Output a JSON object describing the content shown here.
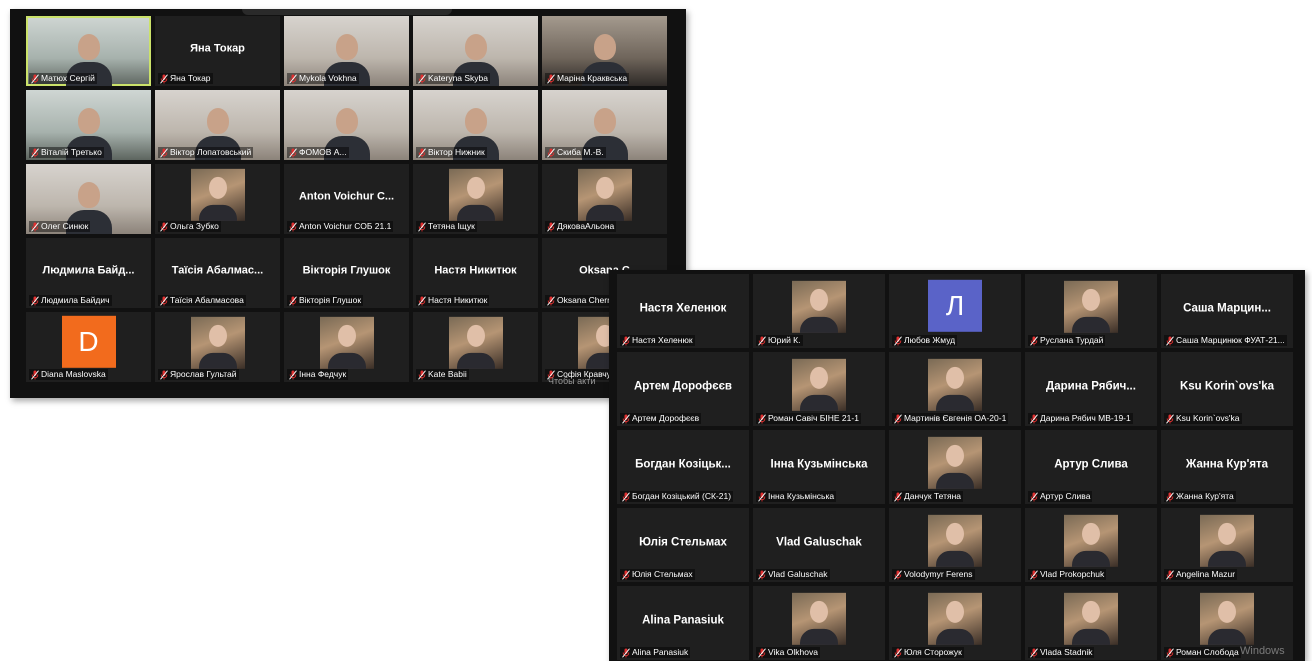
{
  "window1": {
    "tiles": [
      {
        "kind": "video",
        "shade": "cool",
        "label": "Матюх Сергій",
        "active": true
      },
      {
        "kind": "name",
        "big": "Яна Токар",
        "label": "Яна Токар"
      },
      {
        "kind": "video",
        "shade": "warm",
        "label": "Mykola Vokhna"
      },
      {
        "kind": "video",
        "shade": "warm",
        "label": "Kateryna Skyba"
      },
      {
        "kind": "video",
        "shade": "dark",
        "label": "Маріна Краквська"
      },
      {
        "kind": "video",
        "shade": "cool",
        "label": "Віталій Третько"
      },
      {
        "kind": "video",
        "shade": "warm",
        "label": "Віктор Лопатовський"
      },
      {
        "kind": "video",
        "shade": "warm",
        "label": "ФОМОВ А..."
      },
      {
        "kind": "video",
        "shade": "warm",
        "label": "Віктор Нижник"
      },
      {
        "kind": "video",
        "shade": "warm",
        "label": "Скиба М.-В."
      },
      {
        "kind": "video",
        "shade": "warm",
        "label": "Олег Синюк"
      },
      {
        "kind": "photo",
        "label": "Ольга Зубко"
      },
      {
        "kind": "name",
        "big": "Anton Voichur C...",
        "label": "Anton Voichur СОБ 21.1"
      },
      {
        "kind": "photo",
        "label": "Тетяна Іщук"
      },
      {
        "kind": "photo",
        "label": "ДяковаАльона"
      },
      {
        "kind": "name",
        "big": "Людмила Байд...",
        "label": "Людмила Байдич"
      },
      {
        "kind": "name",
        "big": "Таїсія Абалмас...",
        "label": "Таїсія Абалмасова"
      },
      {
        "kind": "name",
        "big": "Вікторія Глушок",
        "label": "Вікторія Глушок"
      },
      {
        "kind": "name",
        "big": "Настя Никитюк",
        "label": "Настя Никитюк"
      },
      {
        "kind": "name",
        "big": "Oksana C",
        "label": "Oksana Cherr"
      },
      {
        "kind": "letter",
        "letter": "D",
        "color": "#f26b1d",
        "label": "Diana Maslovska"
      },
      {
        "kind": "photo",
        "label": "Ярослав Гультай"
      },
      {
        "kind": "photo",
        "label": "Інна Федчук"
      },
      {
        "kind": "photo",
        "label": "Kate Babii"
      },
      {
        "kind": "photo",
        "label": "Софія Кравчу"
      }
    ],
    "overlay_note": "Чтобы акти"
  },
  "window2": {
    "tiles": [
      {
        "kind": "name",
        "big": "Настя Хеленюк",
        "label": "Настя Хеленюк"
      },
      {
        "kind": "photo",
        "label": "Юрий К."
      },
      {
        "kind": "letter",
        "letter": "Л",
        "color": "#5a63c8",
        "label": "Любов Жмуд"
      },
      {
        "kind": "photo",
        "label": "Руслана Турдай"
      },
      {
        "kind": "name",
        "big": "Саша Марцин...",
        "label": "Саша Марцинюк ФУАТ-21..."
      },
      {
        "kind": "name",
        "big": "Артем Дорофєєв",
        "label": "Артем Дорофєєв"
      },
      {
        "kind": "photo",
        "label": "Роман Савіч БІНЕ 21-1"
      },
      {
        "kind": "photo",
        "label": "Мартинів Євгенія ОА-20-1"
      },
      {
        "kind": "name",
        "big": "Дарина Рябич...",
        "label": "Дарина Рябич МВ-19-1"
      },
      {
        "kind": "name",
        "big": "Ksu Korin`ovs'ka",
        "label": "Ksu Korin`ovs'ka"
      },
      {
        "kind": "name",
        "big": "Богдан Козіцьк...",
        "label": "Богдан Козіцький (СК-21)"
      },
      {
        "kind": "name",
        "big": "Інна Кузьмінська",
        "label": "Інна Кузьмінська"
      },
      {
        "kind": "photo",
        "label": "Данчук Тетяна"
      },
      {
        "kind": "name",
        "big": "Артур Слива",
        "label": "Артур Слива"
      },
      {
        "kind": "name",
        "big": "Жанна Кур'ята",
        "label": "Жанна Кур'ята"
      },
      {
        "kind": "name",
        "big": "Юлія Стельмах",
        "label": "Юлія Стельмах"
      },
      {
        "kind": "name",
        "big": "Vlad Galuschak",
        "label": "Vlad Galuschak"
      },
      {
        "kind": "photo",
        "label": "Volodymyr Ferens"
      },
      {
        "kind": "photo",
        "label": "Vlad Prokopchuk"
      },
      {
        "kind": "photo",
        "label": "Angelina Mazur"
      },
      {
        "kind": "name",
        "big": "Alina Panasiuk",
        "label": "Alina Panasiuk"
      },
      {
        "kind": "photo",
        "label": "Vika Olkhova"
      },
      {
        "kind": "photo",
        "label": "Юля Сторожук"
      },
      {
        "kind": "photo",
        "label": "Vlada Stadnik"
      },
      {
        "kind": "photo",
        "label": "Роман Слобода"
      }
    ],
    "overlay_note": "Windows"
  }
}
